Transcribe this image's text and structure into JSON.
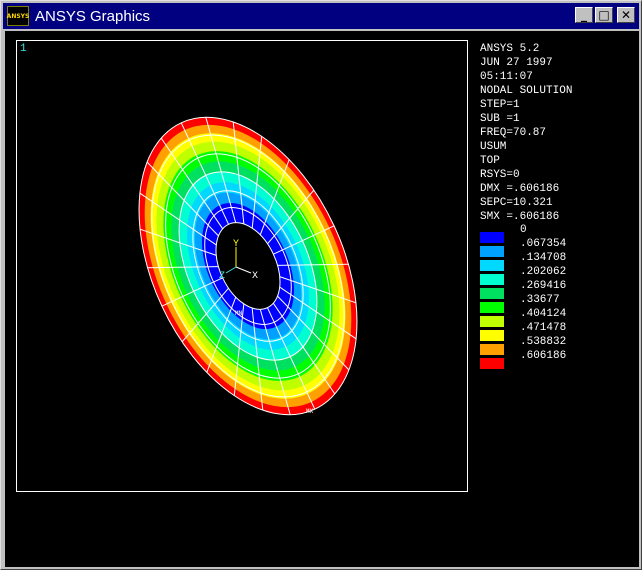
{
  "window": {
    "title": "ANSYS Graphics",
    "icon": "ansys-logo",
    "icon_label": "ANSYS"
  },
  "controls": {
    "minimize": "_",
    "maximize": "□",
    "close": "✕"
  },
  "plot": {
    "window_number": "1",
    "info_lines": [
      "ANSYS 5.2",
      "JUN 27 1997",
      "05:11:07",
      "NODAL SOLUTION",
      "STEP=1",
      "SUB =1",
      "FREQ=70.87",
      "USUM",
      "TOP",
      "RSYS=0",
      "DMX =.606186",
      "SEPC=10.321",
      "SMX =.606186"
    ],
    "legend": [
      {
        "value": "0",
        "color": "#0000ff"
      },
      {
        "value": ".067354",
        "color": "#00a0ff"
      },
      {
        "value": ".134708",
        "color": "#00d8ff"
      },
      {
        "value": ".202062",
        "color": "#00ffd0"
      },
      {
        "value": ".269416",
        "color": "#00e060"
      },
      {
        "value": ".33677",
        "color": "#00ff00"
      },
      {
        "value": ".404124",
        "color": "#c0ff00"
      },
      {
        "value": ".471478",
        "color": "#ffff00"
      },
      {
        "value": ".538832",
        "color": "#ffa000"
      },
      {
        "value": ".606186",
        "color": "#ff0000"
      }
    ],
    "triad": {
      "x": "X",
      "y": "Y",
      "z": "Z"
    },
    "node_labels": [
      "MN",
      "MX"
    ]
  }
}
